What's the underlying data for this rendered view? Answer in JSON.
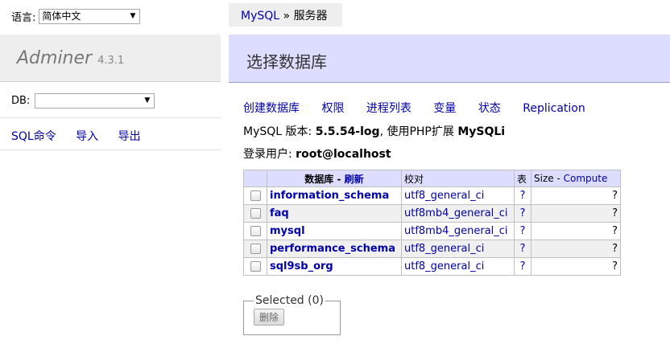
{
  "menu": {
    "language_label": "语言:",
    "language_selected": "简体中文",
    "logo_text": "Adminer",
    "logo_version": "4.3.1",
    "db_label": "DB:",
    "db_selected": "",
    "links": [
      "SQL命令",
      "导入",
      "导出"
    ]
  },
  "breadcrumb": {
    "server_type": "MySQL",
    "separator": "»",
    "current": "服务器"
  },
  "header": {
    "title": "选择数据库"
  },
  "actions": [
    "创建数据库",
    "权限",
    "进程列表",
    "变量",
    "状态",
    "Replication"
  ],
  "info": {
    "version_prefix": "MySQL 版本:",
    "version": "5.5.54-log",
    "php_ext_prefix": ", 使用PHP扩展",
    "php_ext": "MySQLi",
    "login_label": "登录用户:",
    "login_user": "root@localhost"
  },
  "table": {
    "headers": {
      "db": "数据库",
      "dash": "-",
      "refresh": "刷新",
      "collation": "校对",
      "tables": "表",
      "size": "Size",
      "size_dash": "-",
      "compute": "Compute"
    },
    "rows": [
      {
        "name": "information_schema",
        "collation": "utf8_general_ci",
        "tables": "?",
        "size": "?"
      },
      {
        "name": "faq",
        "collation": "utf8mb4_general_ci",
        "tables": "?",
        "size": "?"
      },
      {
        "name": "mysql",
        "collation": "utf8mb4_general_ci",
        "tables": "?",
        "size": "?"
      },
      {
        "name": "performance_schema",
        "collation": "utf8_general_ci",
        "tables": "?",
        "size": "?"
      },
      {
        "name": "sql9sb_org",
        "collation": "utf8_general_ci",
        "tables": "?",
        "size": "?"
      }
    ]
  },
  "selected": {
    "legend": "Selected (0)",
    "delete_button": "删除"
  },
  "colors": {
    "link": "#0000aa",
    "header_bg": "#ddddff",
    "menu_band_bg": "#eeeeee"
  }
}
